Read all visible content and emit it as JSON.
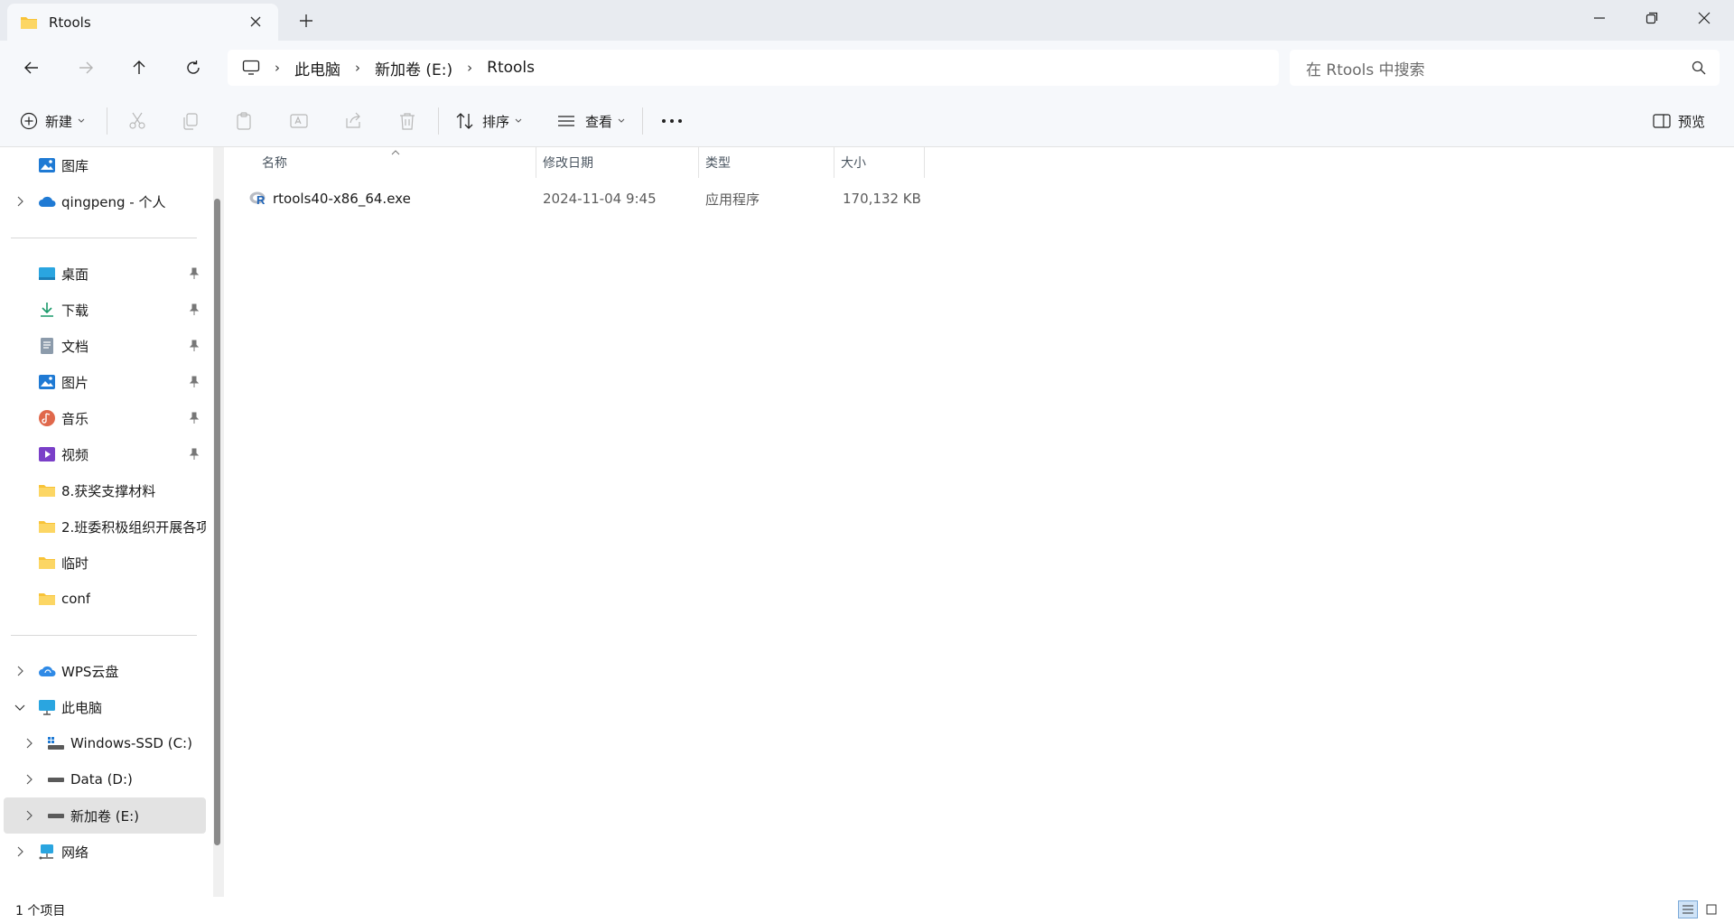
{
  "window": {
    "tab_title": "Rtools",
    "colors": {
      "accent": "#0067c0",
      "folder": "#f8c338",
      "titlebar": "#e8ebf0"
    }
  },
  "address": {
    "crumbs": [
      "此电脑",
      "新加卷 (E:)",
      "Rtools"
    ],
    "search_placeholder": "在 Rtools 中搜索"
  },
  "commands": {
    "new": "新建",
    "sort": "排序",
    "view": "查看",
    "preview": "预览"
  },
  "sidebar": {
    "top": [
      {
        "label": "图库",
        "icon": "gallery-icon"
      },
      {
        "label": "qingpeng - 个人",
        "icon": "onedrive-icon"
      }
    ],
    "quick": [
      {
        "label": "桌面",
        "icon": "desktop-icon"
      },
      {
        "label": "下载",
        "icon": "download-icon"
      },
      {
        "label": "文档",
        "icon": "document-icon"
      },
      {
        "label": "图片",
        "icon": "pictures-icon"
      },
      {
        "label": "音乐",
        "icon": "music-icon"
      },
      {
        "label": "视频",
        "icon": "video-icon"
      },
      {
        "label": "8.获奖支撑材料",
        "icon": "folder-icon"
      },
      {
        "label": "2.班委积极组织开展各项",
        "icon": "folder-icon"
      },
      {
        "label": "临时",
        "icon": "folder-icon"
      },
      {
        "label": "conf",
        "icon": "folder-icon"
      }
    ],
    "tree": [
      {
        "label": "WPS云盘",
        "icon": "wps-cloud-icon"
      },
      {
        "label": "此电脑",
        "icon": "this-pc-icon"
      },
      {
        "label": "Windows-SSD (C:)",
        "icon": "drive-c-icon"
      },
      {
        "label": "Data (D:)",
        "icon": "drive-icon"
      },
      {
        "label": "新加卷 (E:)",
        "icon": "drive-icon"
      },
      {
        "label": "网络",
        "icon": "network-icon"
      }
    ]
  },
  "table": {
    "headers": [
      "名称",
      "修改日期",
      "类型",
      "大小"
    ],
    "rows": [
      {
        "name": "rtools40-x86_64.exe",
        "date": "2024-11-04 9:45",
        "type": "应用程序",
        "size": "170,132 KB"
      }
    ]
  },
  "status": {
    "count": "1 个项目"
  }
}
